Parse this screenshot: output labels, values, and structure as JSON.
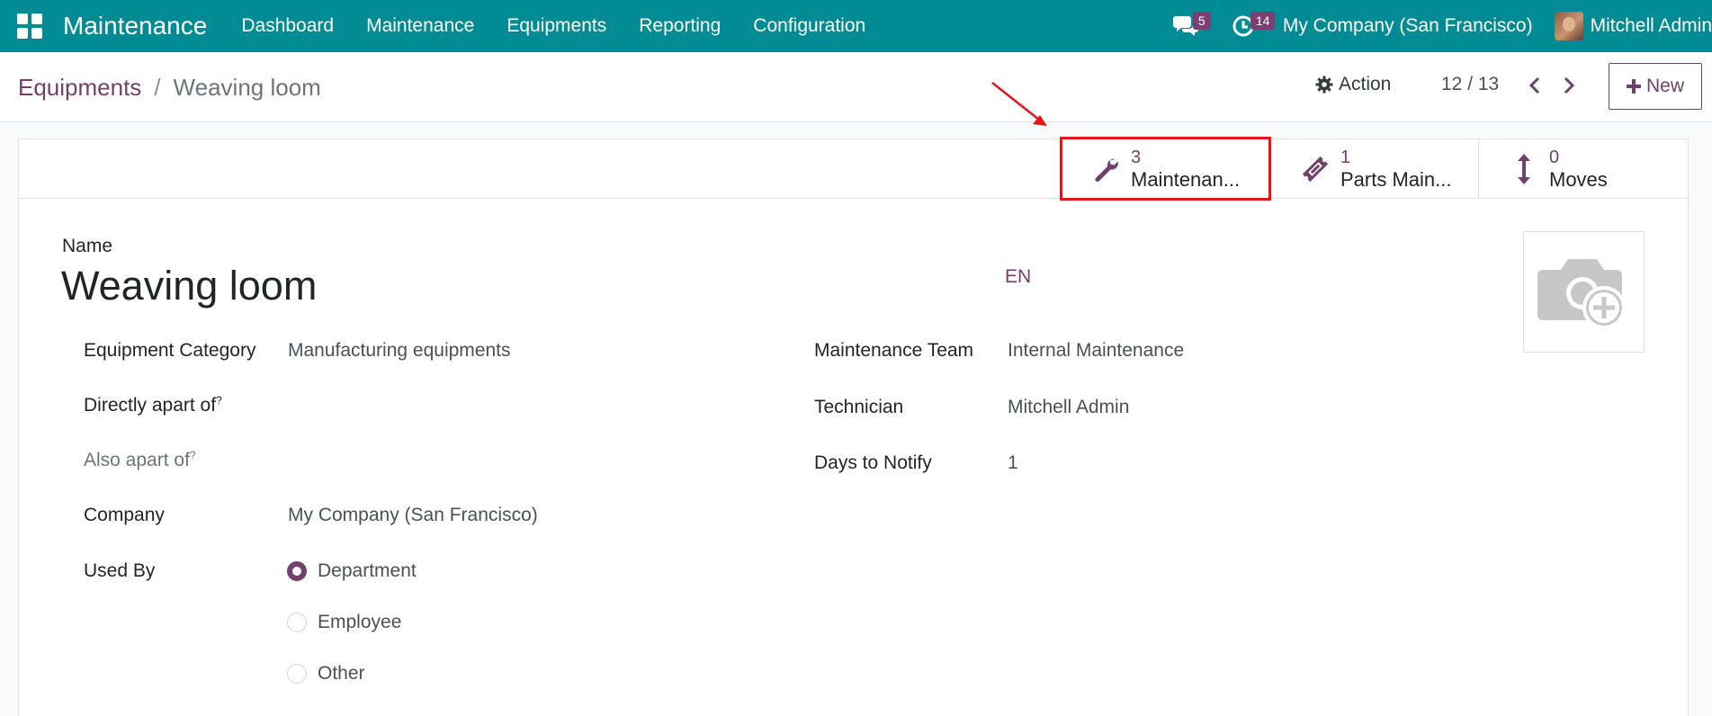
{
  "navbar": {
    "app_name": "Maintenance",
    "menu": [
      "Dashboard",
      "Maintenance",
      "Equipments",
      "Reporting",
      "Configuration"
    ],
    "messages_count": "5",
    "activities_count": "14",
    "company": "My Company (San Francisco)",
    "user": "Mitchell Admin",
    "color": "#018c95"
  },
  "control_panel": {
    "breadcrumb_parent": "Equipments",
    "breadcrumb_separator": "/",
    "breadcrumb_current": "Weaving loom",
    "action_label": "Action",
    "pager": "12 / 13",
    "new_label": "New"
  },
  "stat_buttons": [
    {
      "value": "3",
      "label": "Maintenan...",
      "icon": "wrench-icon"
    },
    {
      "value": "1",
      "label": "Parts Main...",
      "icon": "ticket-icon"
    },
    {
      "value": "0",
      "label": "Moves",
      "icon": "vertical-arrows-icon"
    }
  ],
  "form": {
    "name_label": "Name",
    "name_value": "Weaving loom",
    "lang": "EN",
    "left": {
      "category_label": "Equipment Category",
      "category_value": "Manufacturing equipments",
      "directly_label": "Directly apart of",
      "also_label": "Also apart of",
      "help_mark": "?",
      "company_label": "Company",
      "company_value": "My Company (San Francisco)",
      "used_by_label": "Used By",
      "used_by_options": [
        "Department",
        "Employee",
        "Other"
      ],
      "used_by_selected": "Department"
    },
    "right": {
      "team_label": "Maintenance Team",
      "team_value": "Internal Maintenance",
      "technician_label": "Technician",
      "technician_value": "Mitchell Admin",
      "notify_label": "Days to Notify",
      "notify_value": "1"
    }
  },
  "colors": {
    "accent": "#71416b",
    "highlight": "#e8141b"
  }
}
